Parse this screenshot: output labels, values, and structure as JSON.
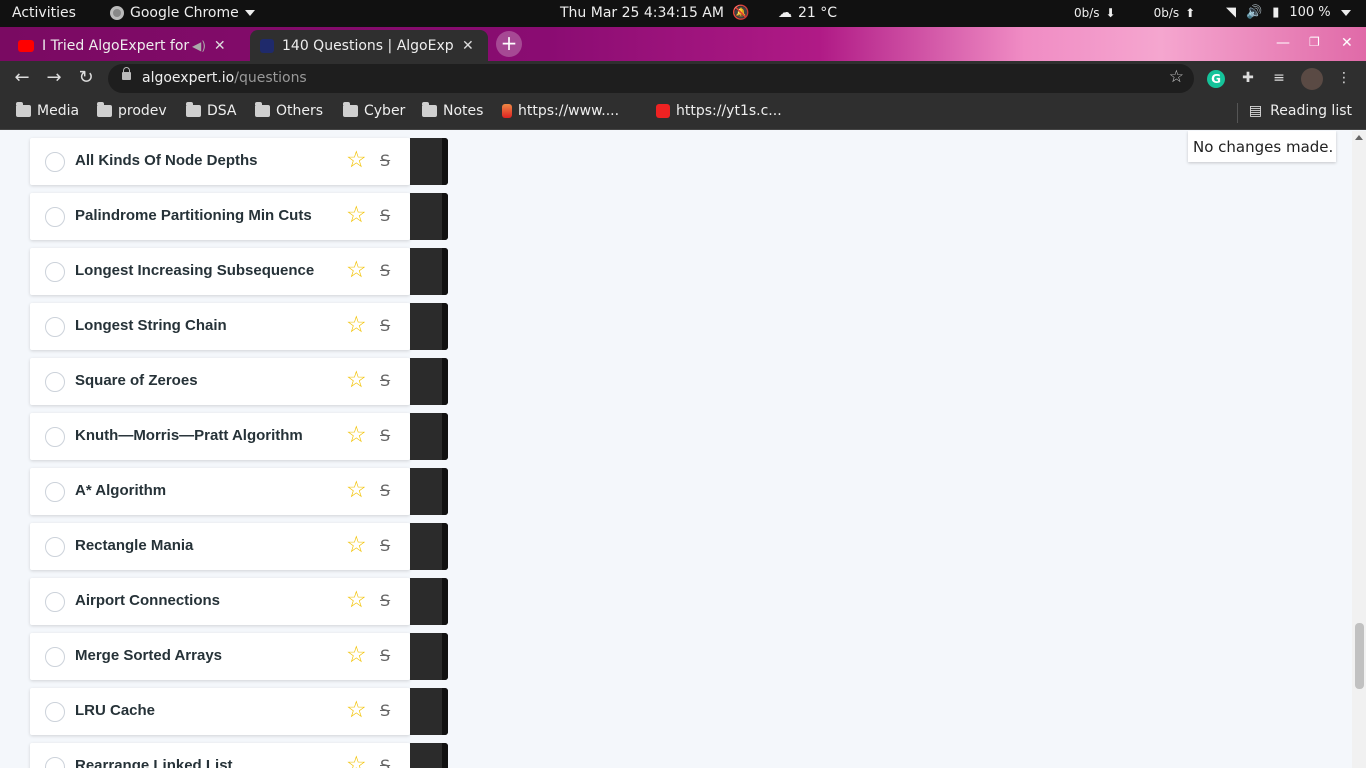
{
  "topbar": {
    "activities": "Activities",
    "app_menu": "Google Chrome",
    "datetime": "Thu Mar 25   4:34:15 AM",
    "weather": "21 °C",
    "net_down": "0b/s",
    "net_up": "0b/s",
    "battery": "100 %"
  },
  "tabs": [
    {
      "title": "I Tried AlgoExpert for",
      "favicon": "youtube-icon",
      "color": "#ff0000"
    },
    {
      "title": "140 Questions | AlgoExpe",
      "favicon": "algoexpert-icon",
      "color": "#1f2a6b"
    }
  ],
  "omnibox": {
    "domain": "algoexpert.io",
    "path": "/questions"
  },
  "bookmarks": [
    {
      "label": "Media",
      "type": "folder"
    },
    {
      "label": "prodev",
      "type": "folder"
    },
    {
      "label": "DSA",
      "type": "folder"
    },
    {
      "label": "Others",
      "type": "folder"
    },
    {
      "label": "Cyber",
      "type": "folder"
    },
    {
      "label": "Notes",
      "type": "folder"
    },
    {
      "label": "https://www....",
      "type": "site"
    },
    {
      "label": "https://yt1s.c...",
      "type": "site"
    }
  ],
  "reading_list": "Reading list",
  "toast": "No changes made.",
  "questions": [
    "All Kinds Of Node Depths",
    "Palindrome Partitioning Min Cuts",
    "Longest Increasing Subsequence",
    "Longest String Chain",
    "Square of Zeroes",
    "Knuth—Morris—Pratt Algorithm",
    "A* Algorithm",
    "Rectangle Mania",
    "Airport Connections",
    "Merge Sorted Arrays",
    "LRU Cache",
    "Rearrange Linked List"
  ],
  "colors": {
    "star": "#f2c200",
    "accent_tab": "#2f2f2f"
  }
}
